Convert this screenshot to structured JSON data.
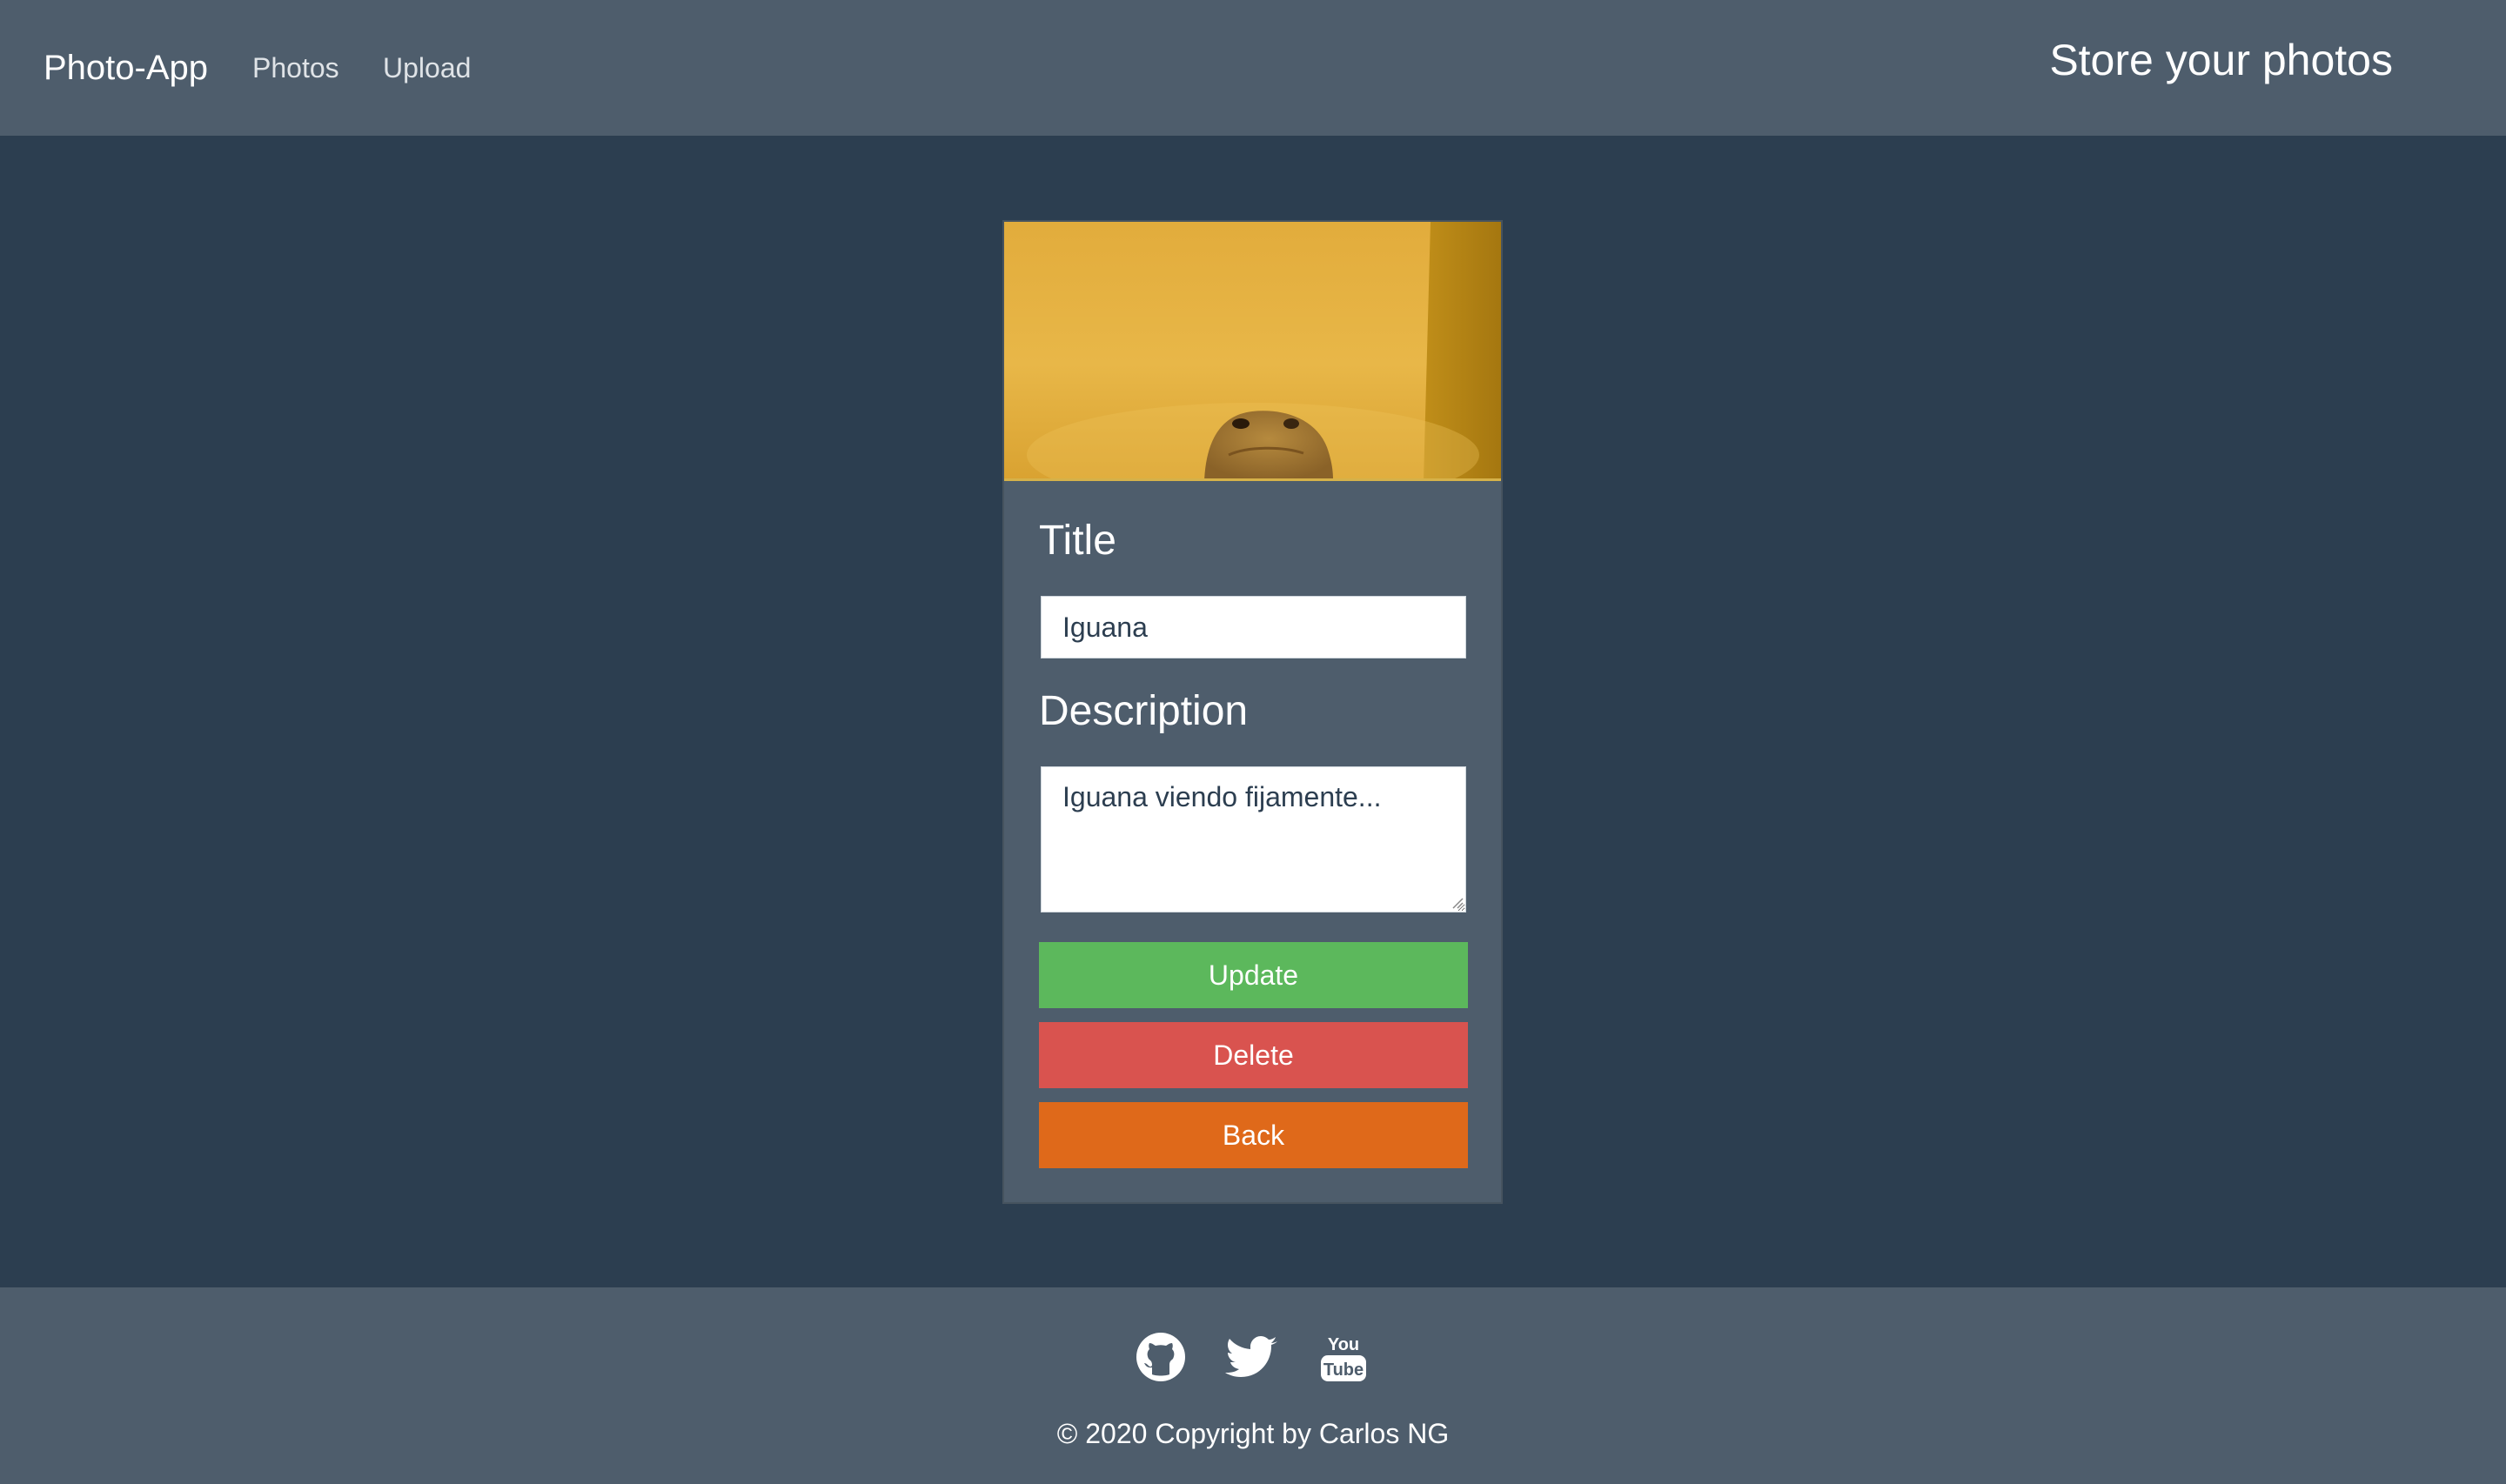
{
  "navbar": {
    "brand": "Photo-App",
    "links": [
      {
        "label": "Photos"
      },
      {
        "label": "Upload"
      }
    ],
    "tagline": "Store your photos"
  },
  "card": {
    "image_subject": "iguana",
    "title_label": "Title",
    "title_value": "Iguana",
    "description_label": "Description",
    "description_value": "Iguana viendo fijamente...",
    "buttons": {
      "update": "Update",
      "delete": "Delete",
      "back": "Back"
    }
  },
  "footer": {
    "icons": [
      "github-icon",
      "twitter-icon",
      "youtube-icon"
    ],
    "youtube_text_top": "You",
    "youtube_text_bottom": "Tube",
    "copyright": "© 2020 Copyright by Carlos NG"
  },
  "colors": {
    "navbar": "#4e5d6c",
    "background": "#2c3e50",
    "update": "#5cb85c",
    "delete": "#d9534f",
    "back": "#df691a"
  }
}
